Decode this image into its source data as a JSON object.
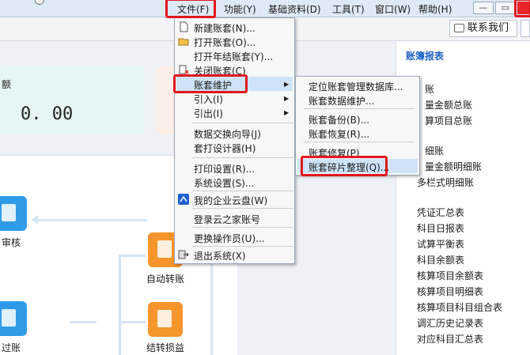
{
  "menubar": {
    "items": [
      "文件(F)",
      "功能(Y)",
      "基础资料(D)",
      "工具(T)",
      "窗口(W)",
      "帮助(H)"
    ],
    "window_buttons": [
      "—",
      "▭"
    ]
  },
  "toolbar": {
    "contact_label": "联系我们"
  },
  "dashboard": {
    "stat_label": "额",
    "stat_value": "0. 00",
    "tiles": [
      "审核",
      "自动转账",
      "过账",
      "结转损益"
    ]
  },
  "report_panel": {
    "title": "账簿报表",
    "items": [
      "账",
      "量金额总账",
      "算项目总账",
      "细账",
      "量金额明细账",
      "多栏式明细账",
      "凭证汇总表",
      "科目日报表",
      "试算平衡表",
      "科目余额表",
      "核算项目余额表",
      "核算项目明细表",
      "核算项目科目组合表",
      "调汇历史记录表",
      "对应科目汇总表"
    ]
  },
  "file_menu": {
    "items": [
      {
        "label": "新建账套(N)...",
        "icon": "new-file-icon"
      },
      {
        "label": "打开账套(O)...",
        "icon": "open-folder-icon"
      },
      {
        "label": "打开年结账套(Y)...",
        "icon": ""
      },
      {
        "label": "关闭账套(C)",
        "icon": "close-book-icon"
      },
      {
        "label": "账套维护",
        "icon": ""
      },
      {
        "label": "引入(I)",
        "icon": ""
      },
      {
        "label": "引出(I)",
        "icon": ""
      },
      {
        "label": "数据交换向导(J)",
        "icon": ""
      },
      {
        "label": "套打设计器(H)",
        "icon": ""
      },
      {
        "label": "打印设置(R)...",
        "icon": ""
      },
      {
        "label": "系统设置(S)...",
        "icon": ""
      },
      {
        "label": "我的企业云盘(W)",
        "icon": "cloud-disk-icon"
      },
      {
        "label": "登录云之家账号",
        "icon": ""
      },
      {
        "label": "更换操作员(U)...",
        "icon": ""
      },
      {
        "label": "退出系统(X)",
        "icon": "exit-icon"
      }
    ]
  },
  "submenu": {
    "items": [
      "定位账套管理数据库...",
      "账套数据维护...",
      "账套备份(B)...",
      "账套恢复(R)...",
      "账套修复(P)",
      "账套碎片整理(Q)..."
    ]
  }
}
